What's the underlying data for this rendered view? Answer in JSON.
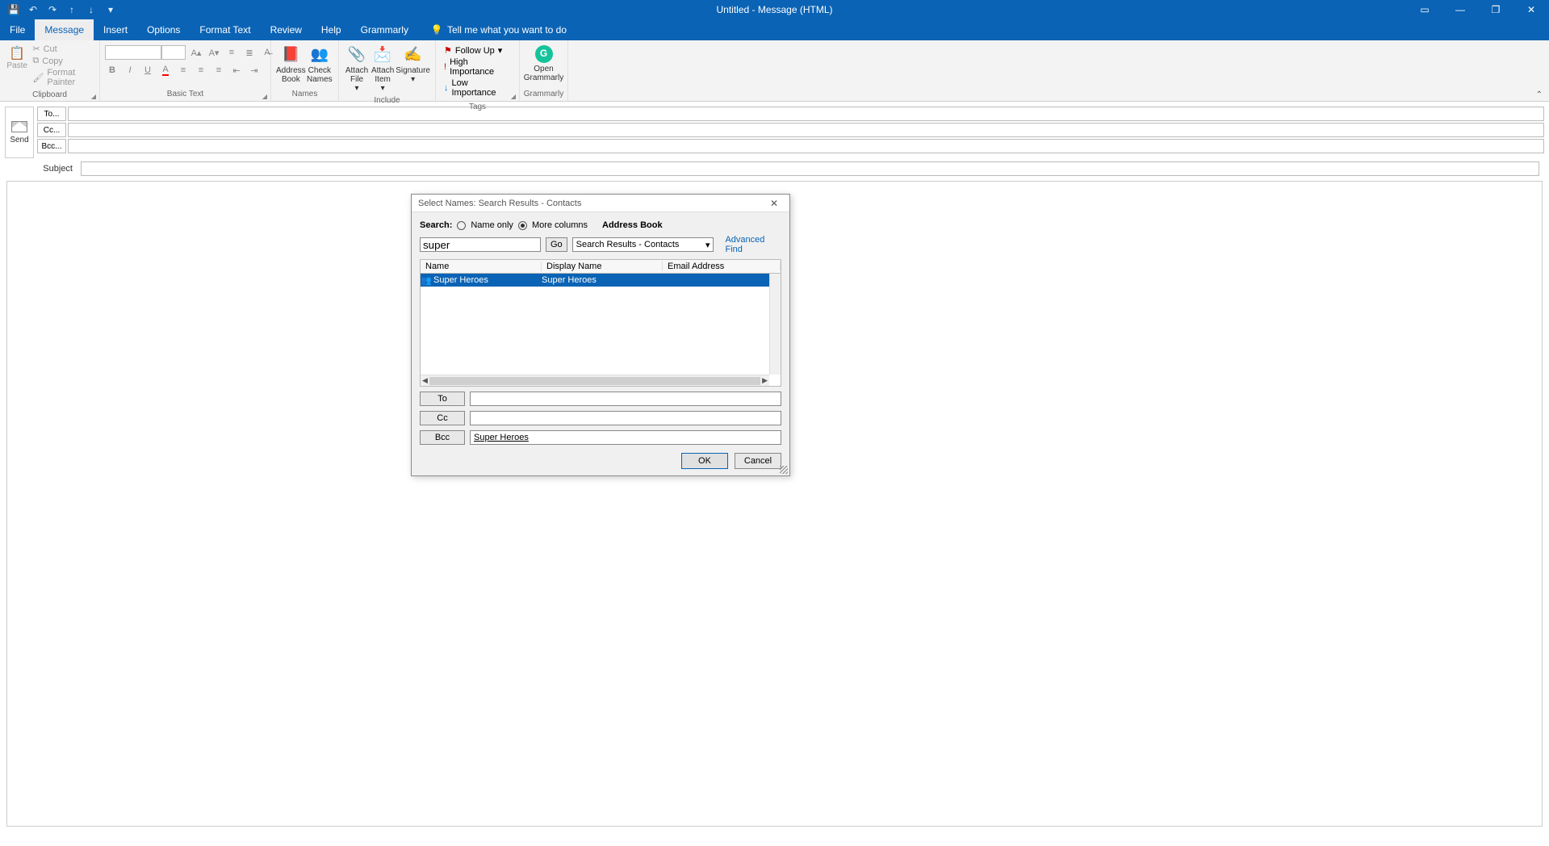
{
  "window": {
    "title": "Untitled  -  Message (HTML)"
  },
  "qat": {
    "save": "💾",
    "undo": "↶",
    "redo": "↷",
    "up": "↑",
    "down": "↓",
    "more": "▾"
  },
  "menu": {
    "file": "File",
    "message": "Message",
    "insert": "Insert",
    "options": "Options",
    "format": "Format Text",
    "review": "Review",
    "help": "Help",
    "grammarly": "Grammarly",
    "tell": "Tell me what you want to do"
  },
  "ribbon": {
    "clipboard": {
      "paste": "Paste",
      "cut": "Cut",
      "copy": "Copy",
      "painter": "Format Painter",
      "label": "Clipboard"
    },
    "basictext": {
      "label": "Basic Text"
    },
    "names": {
      "address": "Address Book",
      "check": "Check Names",
      "label": "Names"
    },
    "include": {
      "attachfile": "Attach File",
      "attachitem": "Attach Item",
      "signature": "Signature",
      "label": "Include"
    },
    "tags": {
      "follow": "Follow Up",
      "high": "High Importance",
      "low": "Low Importance",
      "label": "Tags"
    },
    "grammarly": {
      "open": "Open Grammarly",
      "label": "Grammarly"
    }
  },
  "fields": {
    "send": "Send",
    "to": "To...",
    "cc": "Cc...",
    "bcc": "Bcc...",
    "subject": "Subject"
  },
  "dialog": {
    "title": "Select Names: Search Results - Contacts",
    "search_label": "Search:",
    "name_only": "Name only",
    "more_cols": "More columns",
    "ab_label": "Address Book",
    "search_value": "super",
    "go": "Go",
    "ab_select": "Search Results - Contacts",
    "adv_find": "Advanced Find",
    "cols": {
      "name": "Name",
      "display": "Display Name",
      "email": "Email Address"
    },
    "result": {
      "name": "Super Heroes",
      "display": "Super Heroes"
    },
    "to": "To",
    "cc": "Cc",
    "bcc": "Bcc",
    "bcc_value": "Super Heroes",
    "ok": "OK",
    "cancel": "Cancel"
  }
}
